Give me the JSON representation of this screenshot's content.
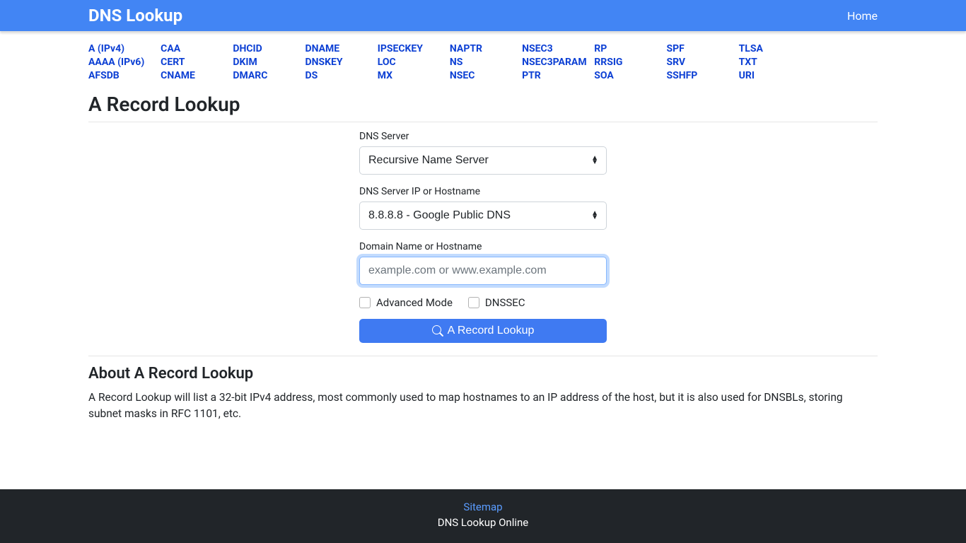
{
  "navbar": {
    "brand": "DNS Lookup",
    "home": "Home"
  },
  "recordtypes": [
    [
      "A (IPv4)",
      "AAAA (IPv6)",
      "AFSDB"
    ],
    [
      "CAA",
      "CERT",
      "CNAME"
    ],
    [
      "DHCID",
      "DKIM",
      "DMARC"
    ],
    [
      "DNAME",
      "DNSKEY",
      "DS"
    ],
    [
      "IPSECKEY",
      "LOC",
      "MX"
    ],
    [
      "NAPTR",
      "NS",
      "NSEC"
    ],
    [
      "NSEC3",
      "NSEC3PARAM",
      "PTR"
    ],
    [
      "RP",
      "RRSIG",
      "SOA"
    ],
    [
      "SPF",
      "SRV",
      "SSHFP"
    ],
    [
      "TLSA",
      "TXT",
      "URI"
    ]
  ],
  "page": {
    "title": "A Record Lookup"
  },
  "form": {
    "dns_server_label": "DNS Server",
    "dns_server_value": "Recursive Name Server",
    "dns_ip_label": "DNS Server IP or Hostname",
    "dns_ip_value": "8.8.8.8 - Google Public DNS",
    "domain_label": "Domain Name or Hostname",
    "domain_placeholder": "example.com or www.example.com",
    "advanced_label": "Advanced Mode",
    "dnssec_label": "DNSSEC",
    "submit_label": "A Record Lookup"
  },
  "about": {
    "title": "About A Record Lookup",
    "text": "A Record Lookup will list a 32-bit IPv4 address, most commonly used to map hostnames to an IP address of the host, but it is also used for DNSBLs, storing subnet masks in RFC 1101, etc."
  },
  "footer": {
    "sitemap": "Sitemap",
    "tagline": "DNS Lookup Online"
  }
}
